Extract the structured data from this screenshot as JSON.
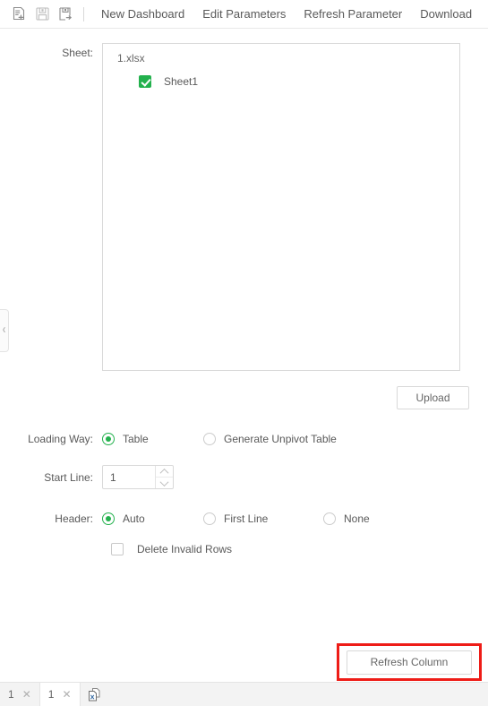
{
  "toolbar": {
    "icons": [
      {
        "name": "new-document-icon",
        "title": "New"
      },
      {
        "name": "save-icon",
        "title": "Save"
      },
      {
        "name": "save-as-icon",
        "title": "Save As"
      }
    ],
    "menu": [
      {
        "label": "New Dashboard"
      },
      {
        "label": "Edit Parameters"
      },
      {
        "label": "Refresh Parameter"
      },
      {
        "label": "Download"
      }
    ]
  },
  "sidebar_handle": {
    "icon": "chevron-left-icon",
    "glyph": "‹"
  },
  "form": {
    "sheet": {
      "label": "Sheet:",
      "file_name": "1.xlsx",
      "items": [
        {
          "label": "Sheet1",
          "checked": true
        }
      ]
    },
    "upload_button": "Upload",
    "loading_way": {
      "label": "Loading Way:",
      "options": [
        {
          "label": "Table",
          "selected": true
        },
        {
          "label": "Generate Unpivot Table",
          "selected": false
        }
      ]
    },
    "start_line": {
      "label": "Start Line:",
      "value": "1",
      "placeholder": "1"
    },
    "header": {
      "label": "Header:",
      "options": [
        {
          "label": "Auto",
          "selected": true
        },
        {
          "label": "First Line",
          "selected": false
        },
        {
          "label": "None",
          "selected": false
        }
      ]
    },
    "delete_invalid_rows": {
      "label": "Delete Invalid Rows",
      "checked": false
    },
    "refresh_column_button": "Refresh Column"
  },
  "tabbar": {
    "tabs": [
      {
        "label": "1",
        "close": "✕",
        "active": false
      },
      {
        "label": "1",
        "close": "✕",
        "active": true
      }
    ],
    "add_icon": "excel-file-icon"
  },
  "colors": {
    "accent_green": "#23b14d",
    "highlight_red": "#ee1c17",
    "border": "#d9d9d9",
    "text": "#595959"
  }
}
